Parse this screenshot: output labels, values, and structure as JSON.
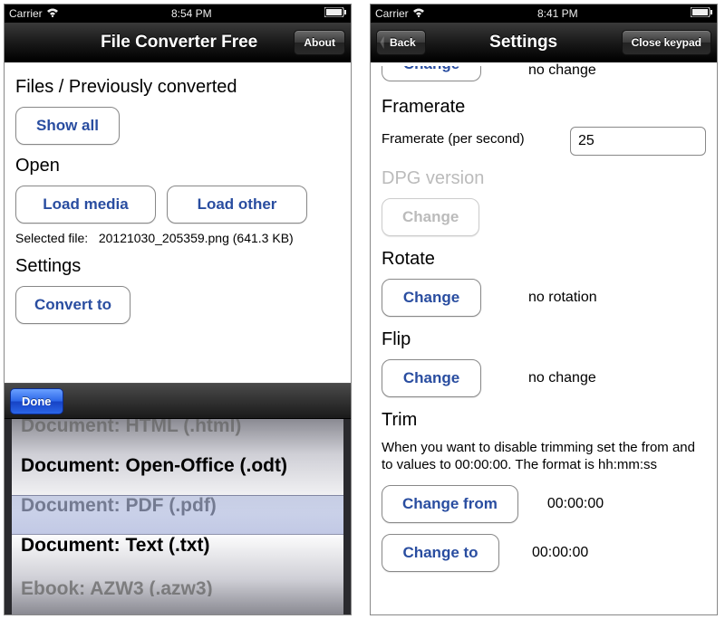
{
  "left": {
    "status": {
      "carrier": "Carrier",
      "time": "8:54 PM"
    },
    "nav": {
      "title": "File Converter Free",
      "about": "About"
    },
    "sections": {
      "files_title": "Files / Previously converted",
      "show_all": "Show all",
      "open_title": "Open",
      "load_media": "Load media",
      "load_other": "Load other",
      "selected_label": "Selected file:",
      "selected_value": "20121030_205359.png (641.3 KB)",
      "settings_title": "Settings",
      "convert_to": "Convert to"
    },
    "picker": {
      "done": "Done",
      "items": [
        "Document: HTML (.html)",
        "Document: Open-Office (.odt)",
        "Document: PDF (.pdf)",
        "Document: Text (.txt)",
        "Ebook: AZW3 (.azw3)"
      ],
      "selected_index": 2
    }
  },
  "right": {
    "status": {
      "carrier": "Carrier",
      "time": "8:41 PM"
    },
    "nav": {
      "back": "Back",
      "title": "Settings",
      "close": "Close keypad"
    },
    "top_partial": {
      "change": "Change",
      "value": "no change"
    },
    "framerate": {
      "title": "Framerate",
      "label": "Framerate (per second)",
      "value": "25"
    },
    "dpg": {
      "title": "DPG version",
      "change": "Change"
    },
    "rotate": {
      "title": "Rotate",
      "change": "Change",
      "value": "no rotation"
    },
    "flip": {
      "title": "Flip",
      "change": "Change",
      "value": "no change"
    },
    "trim": {
      "title": "Trim",
      "help": "When you want to disable trimming set the from and to values to 00:00:00. The format is hh:mm:ss",
      "change_from": "Change from",
      "from_value": "00:00:00",
      "change_to": "Change to",
      "to_value": "00:00:00"
    }
  }
}
